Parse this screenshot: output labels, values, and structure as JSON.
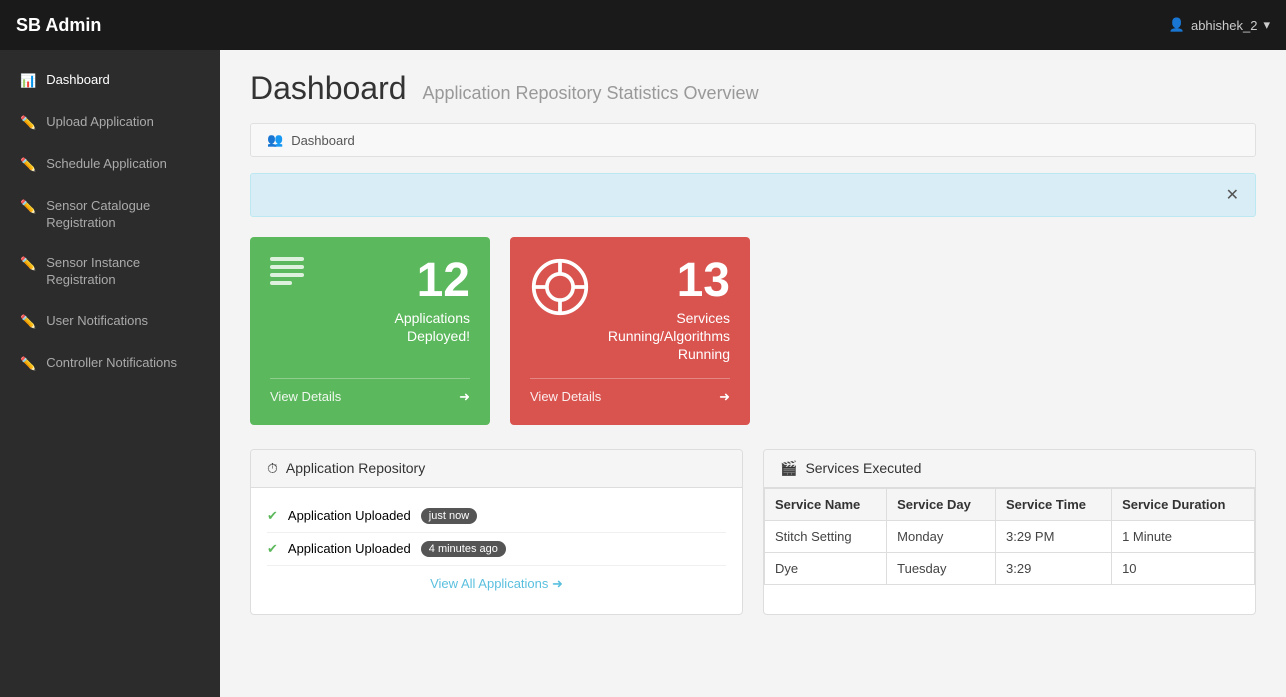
{
  "app": {
    "title": "SB Admin"
  },
  "topbar": {
    "brand": "SB Admin",
    "user_label": "abhishek_2",
    "user_icon": "👤",
    "chevron": "▾"
  },
  "sidebar": {
    "items": [
      {
        "id": "dashboard",
        "label": "Dashboard",
        "icon": "📊"
      },
      {
        "id": "upload-application",
        "label": "Upload Application",
        "icon": "✏️"
      },
      {
        "id": "schedule-application",
        "label": "Schedule Application",
        "icon": "✏️"
      },
      {
        "id": "sensor-catalogue",
        "label": "Sensor Catalogue Registration",
        "icon": "✏️"
      },
      {
        "id": "sensor-instance",
        "label": "Sensor Instance Registration",
        "icon": "✏️"
      },
      {
        "id": "user-notifications",
        "label": "User Notifications",
        "icon": "✏️"
      },
      {
        "id": "controller-notifications",
        "label": "Controller Notifications",
        "icon": "✏️"
      }
    ]
  },
  "page": {
    "title": "Dashboard",
    "subtitle": "Application Repository Statistics Overview",
    "breadcrumb": "Dashboard"
  },
  "stat_cards": [
    {
      "id": "deployed",
      "number": "12",
      "label": "Applications Deployed!",
      "footer_link": "View Details",
      "color": "green"
    },
    {
      "id": "running",
      "number": "13",
      "label": "Services Running/Algorithms Running",
      "footer_link": "View Details",
      "color": "red"
    }
  ],
  "panels": {
    "app_repo": {
      "title": "Application Repository",
      "activities": [
        {
          "text": "Application Uploaded",
          "badge": "just now"
        },
        {
          "text": "Application Uploaded",
          "badge": "4 minutes ago"
        }
      ],
      "view_all": "View All Applications"
    },
    "services": {
      "title": "Services Executed",
      "columns": [
        "Service Name",
        "Service Day",
        "Service Time",
        "Service Duration"
      ],
      "rows": [
        [
          "Stitch Setting",
          "Monday",
          "3:29 PM",
          "1 Minute"
        ],
        [
          "Dye",
          "Tuesday",
          "3:29",
          "10"
        ]
      ]
    }
  }
}
